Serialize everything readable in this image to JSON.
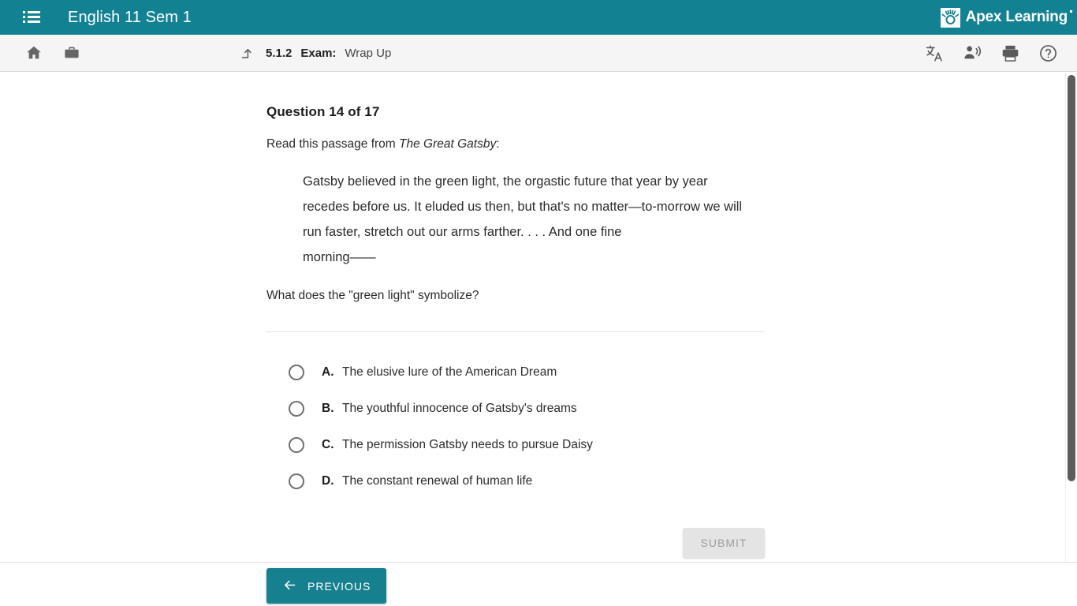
{
  "topbar": {
    "menu_icon": "list-icon",
    "course_title": "English 11 Sem 1",
    "brand_name": "Apex Learning",
    "brand_mark_icon": "apex-sunburst-logo-icon",
    "background_color": "#128293"
  },
  "subbar": {
    "home_icon": "home-icon",
    "briefcase_icon": "briefcase-icon",
    "up_level_icon": "up-level-arrow-icon",
    "breadcrumb": {
      "number": "5.1.2",
      "type": "Exam:",
      "name": "Wrap Up"
    },
    "tools": [
      {
        "icon": "translate-icon",
        "label": "Translate"
      },
      {
        "icon": "read-aloud-icon",
        "label": "Read Aloud"
      },
      {
        "icon": "print-icon",
        "label": "Print"
      },
      {
        "icon": "help-icon",
        "label": "Help"
      }
    ],
    "background_color": "#f5f5f5"
  },
  "question": {
    "heading": "Question 14 of 17",
    "intro_prefix": "Read this passage from ",
    "intro_book_title": "The Great Gatsby",
    "intro_suffix": ":",
    "passage_line_1": "Gatsby believed in the green light, the orgastic future that year by year recedes before us. It eluded us then, but that's no matter—to-morrow we will run faster, stretch out our arms farther. . . . And one fine",
    "passage_line_2": "morning——",
    "prompt": "What does the \"green light\" symbolize?",
    "options": [
      {
        "letter": "A.",
        "text": "The elusive lure of the American Dream",
        "selected": false
      },
      {
        "letter": "B.",
        "text": "The youthful innocence of Gatsby's dreams",
        "selected": false
      },
      {
        "letter": "C.",
        "text": "The permission Gatsby needs to pursue Daisy",
        "selected": false
      },
      {
        "letter": "D.",
        "text": "The constant renewal of human life",
        "selected": false
      }
    ],
    "submit_label": "SUBMIT",
    "submit_enabled": false
  },
  "footer": {
    "previous_label": "PREVIOUS",
    "previous_icon": "arrow-left-icon",
    "previous_color": "#17808f"
  },
  "scrollbar": {
    "thumb_color": "#5c5c5c"
  }
}
